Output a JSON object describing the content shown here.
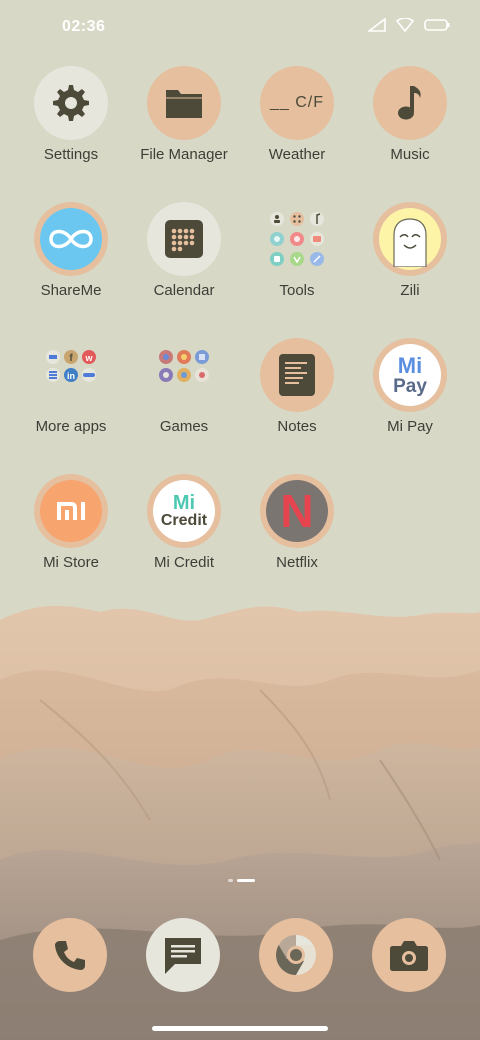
{
  "status_bar": {
    "time": "02:36",
    "icons": [
      "signal-icon",
      "wifi-icon",
      "battery-icon"
    ]
  },
  "apps": [
    {
      "label": "Settings",
      "icon": "gear-icon"
    },
    {
      "label": "File Manager",
      "icon": "folder-icon"
    },
    {
      "label": "Weather",
      "icon": "weather-icon",
      "icon_text": "__ C/F"
    },
    {
      "label": "Music",
      "icon": "music-note-icon"
    },
    {
      "label": "ShareMe",
      "icon": "infinity-icon"
    },
    {
      "label": "Calendar",
      "icon": "calendar-grid-icon"
    },
    {
      "label": "Tools",
      "icon": "tools-folder-icon"
    },
    {
      "label": "Zili",
      "icon": "zili-face-icon"
    },
    {
      "label": "More apps",
      "icon": "more-apps-folder-icon"
    },
    {
      "label": "Games",
      "icon": "games-folder-icon"
    },
    {
      "label": "Notes",
      "icon": "notes-icon"
    },
    {
      "label": "Mi Pay",
      "icon": "mi-pay-icon",
      "icon_text_top": "Mi",
      "icon_text_bottom": "Pay"
    },
    {
      "label": "Mi Store",
      "icon": "mi-store-icon",
      "icon_text": "mi"
    },
    {
      "label": "Mi Credit",
      "icon": "mi-credit-icon",
      "icon_text_top": "Mi",
      "icon_text_bottom": "Credit"
    },
    {
      "label": "Netflix",
      "icon": "netflix-icon",
      "icon_text": "N"
    }
  ],
  "dock": [
    {
      "icon": "phone-icon"
    },
    {
      "icon": "messages-icon"
    },
    {
      "icon": "chrome-icon"
    },
    {
      "icon": "camera-icon"
    }
  ],
  "colors": {
    "background": "#d8d8c6",
    "peach": "#e5bf9e",
    "icon_dark": "#4d4a3a",
    "netflix_red": "#e5434d",
    "shareme_blue": "#6cc7f0",
    "mi_store_orange": "#f7a46f"
  }
}
